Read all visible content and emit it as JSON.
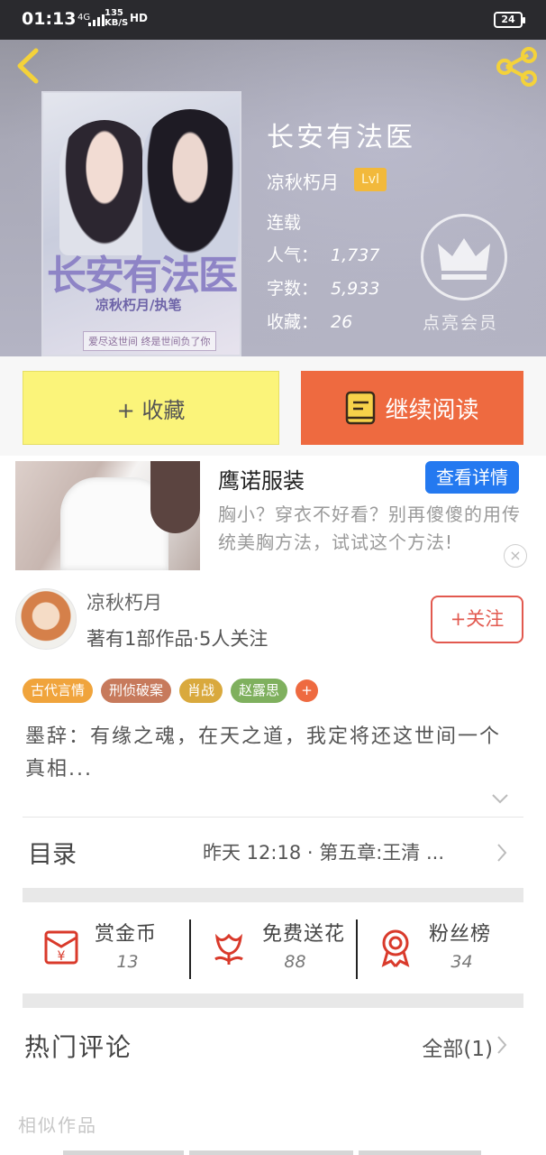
{
  "status_bar": {
    "time": "01:13",
    "network": "4G",
    "speed_value": "135",
    "speed_unit": "KB/S",
    "hd": "HD",
    "battery": "24"
  },
  "book": {
    "title": "长安有法医",
    "author": "凉秋朽月",
    "level": "Lvl",
    "status": "连载",
    "stats": [
      {
        "label": "人气：",
        "value": "1,737"
      },
      {
        "label": "字数：",
        "value": "5,933"
      },
      {
        "label": "收藏：",
        "value": "26"
      }
    ],
    "vip_label": "点亮会员",
    "cover": {
      "title": "长安有法医",
      "author_line": "凉秋朽月/执笔",
      "tagline": "爱尽这世间 终是世间负了你"
    }
  },
  "actions": {
    "favorite": "+ 收藏",
    "continue_reading": "继续阅读"
  },
  "ad": {
    "title": "鹰诺服装",
    "button": "查看详情",
    "description": "胸小？穿衣不好看？别再傻傻的用传统美胸方法，试试这个方法!",
    "close": "×"
  },
  "author_card": {
    "name": "凉秋朽月",
    "summary": "著有1部作品·5人关注",
    "follow": "+关注"
  },
  "tags": [
    {
      "label": "古代言情",
      "color": "#f0a43c"
    },
    {
      "label": "刑侦破案",
      "color": "#c77a5c"
    },
    {
      "label": "肖战",
      "color": "#d9a93d"
    },
    {
      "label": "赵露思",
      "color": "#7fb05e"
    }
  ],
  "tags_more": "+",
  "intro": "墨辞：有缘之魂，在天之道，我定将还这世间一个真相...",
  "toc": {
    "label": "目录",
    "latest": "昨天 12:18 · 第五章:王清 ..."
  },
  "gifts": [
    {
      "label": "赏金币",
      "value": "13"
    },
    {
      "label": "免费送花",
      "value": "88"
    },
    {
      "label": "粉丝榜",
      "value": "34"
    }
  ],
  "comments": {
    "label": "热门评论",
    "all": "全部(1)"
  },
  "similar": {
    "label": "相似作品"
  },
  "colors": {
    "accent_orange": "#ee6a40",
    "favorite_yellow": "#fbf47a",
    "ad_button_blue": "#2479f0",
    "follow_red": "#e2594f",
    "gift_icon_red": "#d93a2b"
  }
}
